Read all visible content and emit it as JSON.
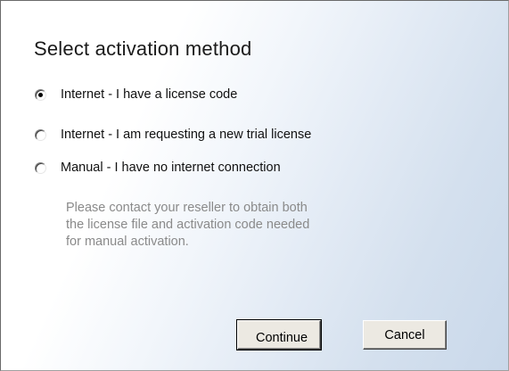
{
  "dialog": {
    "title": "Select activation method",
    "options": [
      {
        "label": "Internet - I have a license code",
        "selected": true
      },
      {
        "label": "Internet - I am requesting a new trial license",
        "selected": false
      },
      {
        "label": "Manual - I have no internet connection",
        "selected": false
      }
    ],
    "note_lines": [
      "Please contact your reseller to obtain both",
      "the license file and activation code needed",
      "for manual activation."
    ],
    "buttons": {
      "continue_label": "Continue",
      "cancel_label": "Cancel"
    }
  }
}
